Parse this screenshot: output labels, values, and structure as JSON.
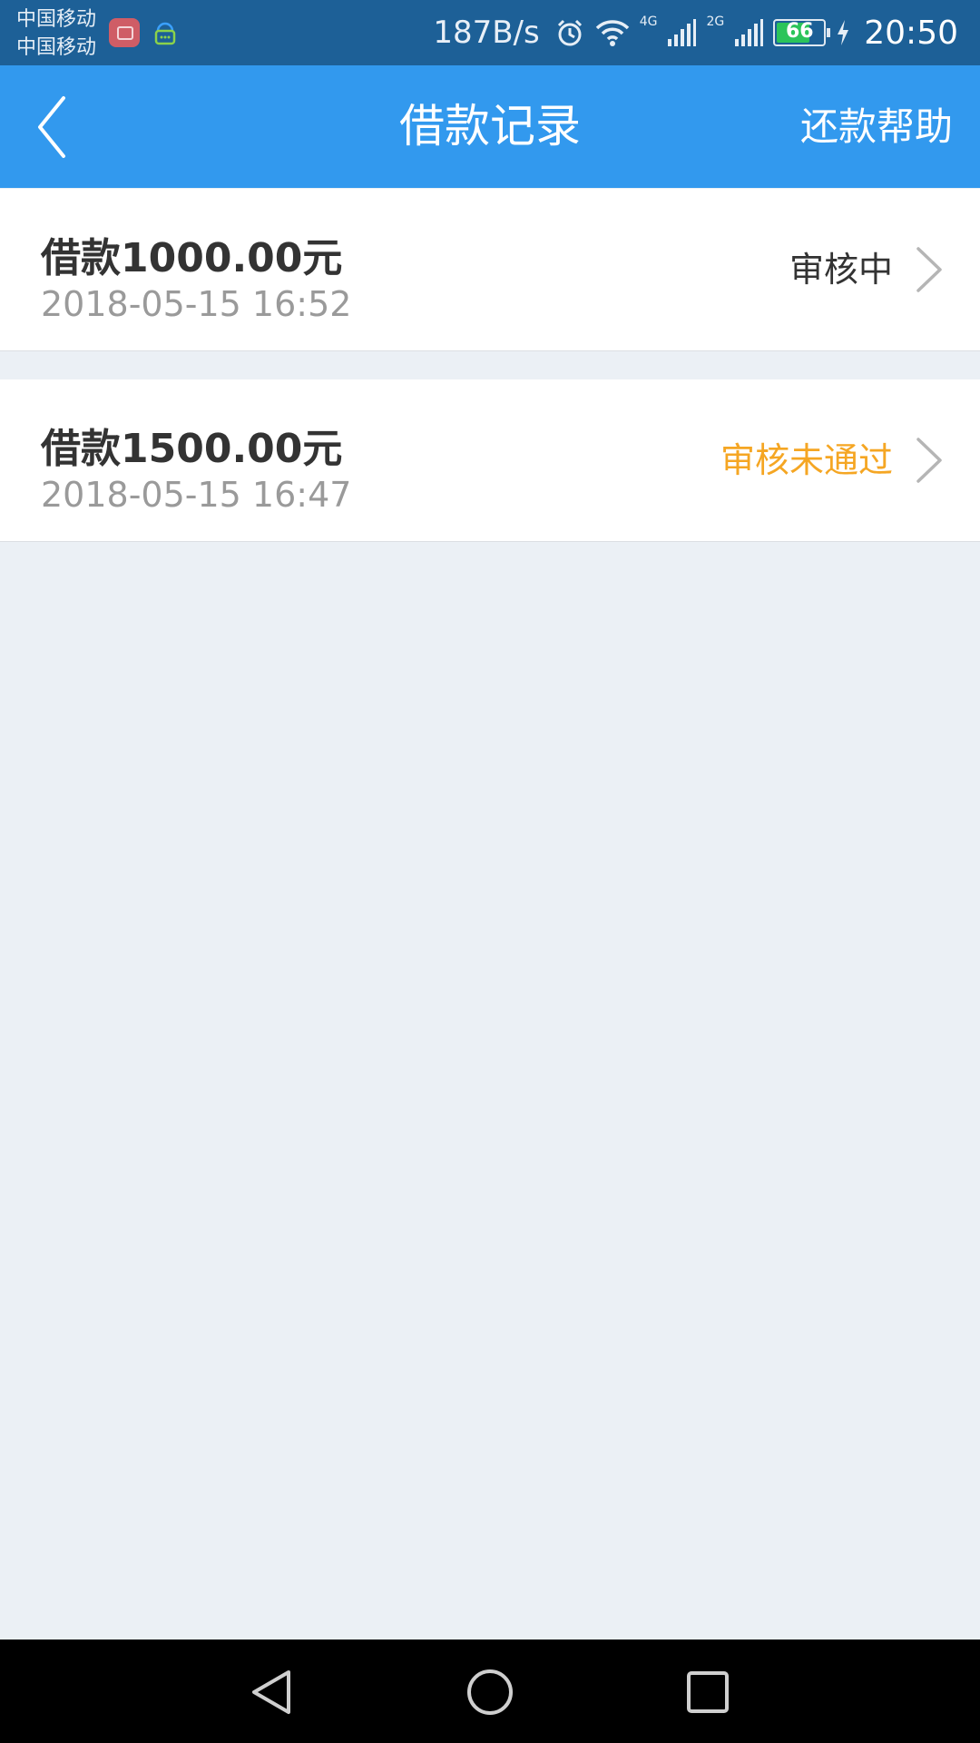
{
  "status_bar": {
    "carrier_1": "中国移动",
    "carrier_2": "中国移动",
    "net_speed": "187B/s",
    "net_type_1": "4G",
    "net_type_2": "2G",
    "battery_level": "66",
    "time": "20:50",
    "icons": [
      "app-notification-icon",
      "chat-notification-icon",
      "alarm-icon",
      "wifi-icon",
      "signal-icon",
      "charging-icon"
    ]
  },
  "app_bar": {
    "title": "借款记录",
    "help_label": "还款帮助",
    "back_icon": "chevron-left-icon"
  },
  "records": [
    {
      "amount": "借款1000.00元",
      "time": "2018-05-15 16:52",
      "status": "审核中",
      "status_color": "#333333"
    },
    {
      "amount": "借款1500.00元",
      "time": "2018-05-15 16:47",
      "status": "审核未通过",
      "status_color": "#f5a623"
    }
  ],
  "nav_bar": {
    "icons": [
      "back-triangle-icon",
      "home-circle-icon",
      "recents-square-icon"
    ]
  },
  "colors": {
    "status_bar_bg": "#1d6097",
    "app_bar_bg": "#3299ee",
    "page_bg": "#ebf0f5",
    "rejected_status": "#f5a623"
  }
}
